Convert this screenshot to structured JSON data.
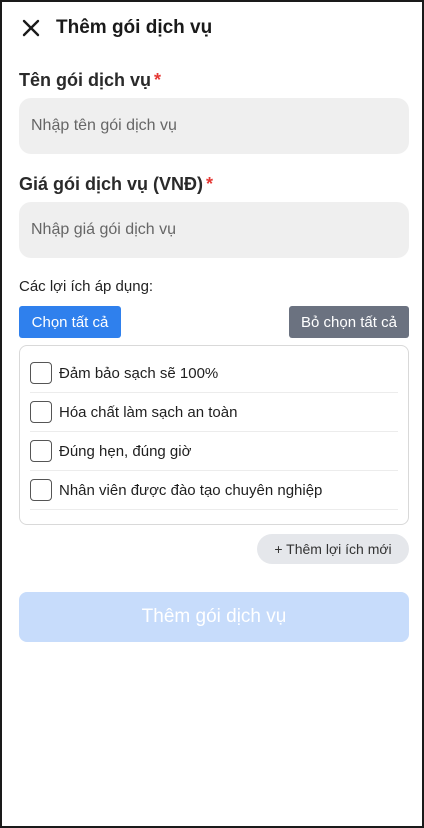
{
  "header": {
    "title": "Thêm gói dịch vụ",
    "close_icon": "close-icon"
  },
  "form": {
    "name_label": "Tên gói dịch vụ",
    "name_required": "*",
    "name_placeholder": "Nhập tên gói dịch vụ",
    "name_value": "",
    "price_label": "Giá gói dịch vụ (VNĐ)",
    "price_required": "*",
    "price_placeholder": "Nhập giá gói dịch vụ",
    "price_value": "",
    "benefits_label": "Các lợi ích áp dụng:",
    "select_all_label": "Chọn tất cả",
    "deselect_all_label": "Bỏ chọn tất cả",
    "benefits": [
      {
        "label": "Đảm bảo sạch sẽ 100%",
        "checked": false
      },
      {
        "label": "Hóa chất làm sạch an toàn",
        "checked": false
      },
      {
        "label": "Đúng hẹn, đúng giờ",
        "checked": false
      },
      {
        "label": "Nhân viên được đào tạo chuyên nghiệp",
        "checked": false
      }
    ],
    "add_benefit_label": "+ Thêm lợi ích mới",
    "submit_label": "Thêm gói dịch vụ"
  },
  "colors": {
    "primary": "#2f80ed",
    "secondary": "#6b7280",
    "required": "#e53935",
    "submit_disabled": "#c7dcfb",
    "input_bg": "#efefef"
  }
}
